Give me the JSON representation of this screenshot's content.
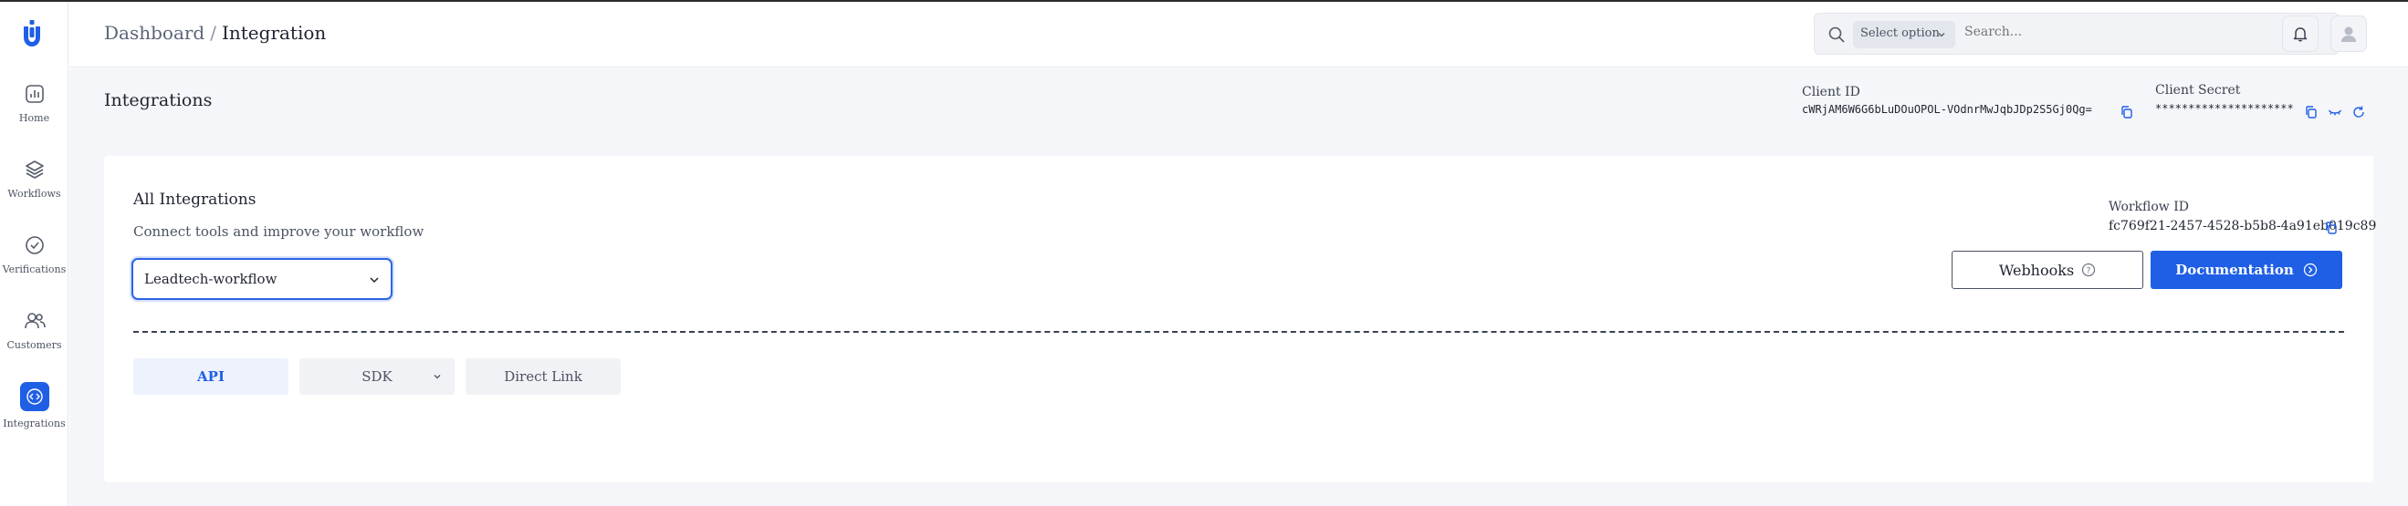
{
  "sidebar": {
    "items": [
      {
        "label": "Home",
        "icon": "chart-icon"
      },
      {
        "label": "Workflows",
        "icon": "layers-icon"
      },
      {
        "label": "Verifications",
        "icon": "check-badge-icon"
      },
      {
        "label": "Customers",
        "icon": "users-icon"
      },
      {
        "label": "Integrations",
        "icon": "code-icon"
      }
    ],
    "active": "Integrations"
  },
  "header": {
    "breadcrumb": [
      "Dashboard",
      "Integration"
    ],
    "search": {
      "select_label": "Select option",
      "placeholder": "Search..."
    },
    "icons": [
      "bell-icon",
      "user-avatar-icon"
    ]
  },
  "page": {
    "title": "Integrations",
    "client_id": {
      "label": "Client ID",
      "value": "cWRjAM6W6G6bLuDOuOPOL-VOdnrMwJqbJDp2S5Gj0Qg="
    },
    "client_secret": {
      "label": "Client Secret",
      "value": "*********************"
    }
  },
  "card": {
    "title": "All Integrations",
    "subtitle": "Connect tools and improve your workflow",
    "workflow_select": "Leadtech-workflow",
    "workflow_id": {
      "label": "Workflow ID",
      "value": "fc769f21-2457-4528-b5b8-4a91eb019c89"
    },
    "webhooks_button": "Webhooks",
    "documentation_button": "Documentation",
    "tabs": [
      {
        "label": "API",
        "active": true
      },
      {
        "label": "SDK",
        "active": false
      },
      {
        "label": "Direct Link",
        "active": false
      }
    ]
  },
  "colors": {
    "accent": "#1f5fe6",
    "bg": "#f5f6f9",
    "card": "#ffffff"
  }
}
